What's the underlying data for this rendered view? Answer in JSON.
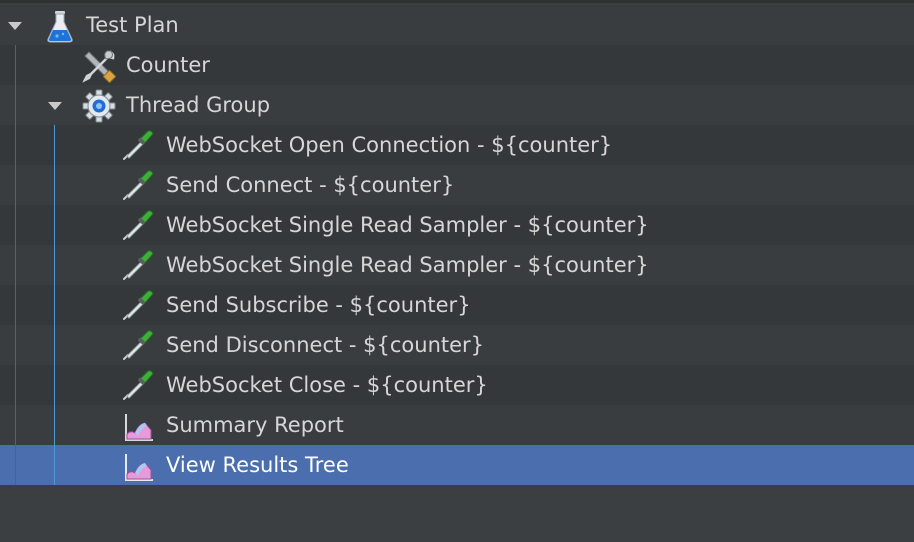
{
  "tree": {
    "root": {
      "label": "Test Plan",
      "icon": "flask-icon",
      "expanded": true,
      "children": [
        {
          "label": "Counter",
          "icon": "tools-icon"
        },
        {
          "label": "Thread Group",
          "icon": "gear-icon",
          "expanded": true,
          "children": [
            {
              "label": "WebSocket Open Connection - ${counter}",
              "icon": "pipette-icon"
            },
            {
              "label": "Send Connect - ${counter}",
              "icon": "pipette-icon"
            },
            {
              "label": "WebSocket Single Read Sampler - ${counter}",
              "icon": "pipette-icon"
            },
            {
              "label": "WebSocket Single Read Sampler - ${counter}",
              "icon": "pipette-icon"
            },
            {
              "label": "Send Subscribe - ${counter}",
              "icon": "pipette-icon"
            },
            {
              "label": "Send Disconnect - ${counter}",
              "icon": "pipette-icon"
            },
            {
              "label": "WebSocket Close - ${counter}",
              "icon": "pipette-icon"
            },
            {
              "label": "Summary Report",
              "icon": "report-chart-icon"
            },
            {
              "label": "View Results Tree",
              "icon": "report-chart-icon",
              "selected": true
            }
          ]
        }
      ]
    }
  },
  "colors": {
    "background": "#3c3f41",
    "selection": "#4b6eaf",
    "text": "#d6d6d6",
    "guide_line": "#4b9ad6"
  }
}
